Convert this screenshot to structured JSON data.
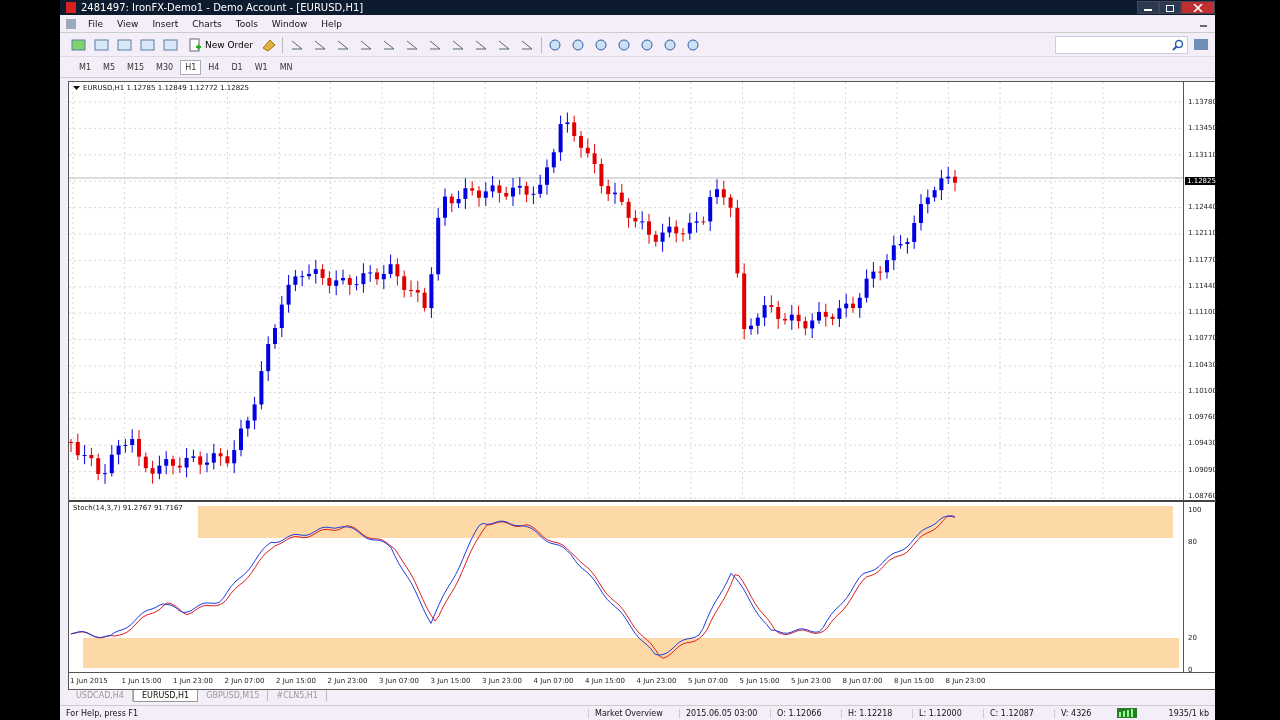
{
  "window": {
    "title": "2481497: IronFX-Demo1 - Demo Account - [EURUSD,H1]"
  },
  "menu": [
    "File",
    "View",
    "Insert",
    "Charts",
    "Tools",
    "Window",
    "Help"
  ],
  "toolbar": {
    "new_order": "New Order"
  },
  "timeframes": [
    {
      "label": "M1",
      "selected": false
    },
    {
      "label": "M5",
      "selected": false
    },
    {
      "label": "M15",
      "selected": false
    },
    {
      "label": "M30",
      "selected": false
    },
    {
      "label": "H1",
      "selected": true
    },
    {
      "label": "H4",
      "selected": false
    },
    {
      "label": "D1",
      "selected": false
    },
    {
      "label": "W1",
      "selected": false
    },
    {
      "label": "MN",
      "selected": false
    }
  ],
  "chart": {
    "legend": "EURUSD,H1  1.12785 1.12849 1.12772 1.12825",
    "current_price": "1.12825",
    "price_axis": [
      "1.13780",
      "1.13450",
      "1.13110",
      "1.12440",
      "1.12110",
      "1.11770",
      "1.11440",
      "1.11100",
      "1.10770",
      "1.10430",
      "1.10100",
      "1.09760",
      "1.09430",
      "1.09090",
      "1.08760"
    ]
  },
  "indicator": {
    "legend": "Stoch(14,3,7) 91.2767 91.7167",
    "axis": [
      "100",
      "80",
      "20",
      "0"
    ]
  },
  "time_axis": [
    "1 Jun 2015",
    "1 Jun 15:00",
    "1 Jun 23:00",
    "2 Jun 07:00",
    "2 Jun 15:00",
    "2 Jun 23:00",
    "3 Jun 07:00",
    "3 Jun 15:00",
    "3 Jun 23:00",
    "4 Jun 07:00",
    "4 Jun 15:00",
    "4 Jun 23:00",
    "5 Jun 07:00",
    "5 Jun 15:00",
    "5 Jun 23:00",
    "8 Jun 07:00",
    "8 Jun 15:00",
    "8 Jun 23:00"
  ],
  "tabs": [
    {
      "label": "USDCAD,H4",
      "selected": false
    },
    {
      "label": "EURUSD,H1",
      "selected": true
    },
    {
      "label": "GBPUSD,M15",
      "selected": false
    },
    {
      "label": "#CLN5,H1",
      "selected": false
    }
  ],
  "status": {
    "help": "For Help, press F1",
    "market": "Market Overview",
    "time": "2015.06.05 03:00",
    "open": "O: 1.12066",
    "high": "H: 1.12218",
    "low": "L: 1.12000",
    "close": "C: 1.12087",
    "volume": "V: 4326",
    "traffic": "1935/1 kb"
  }
}
